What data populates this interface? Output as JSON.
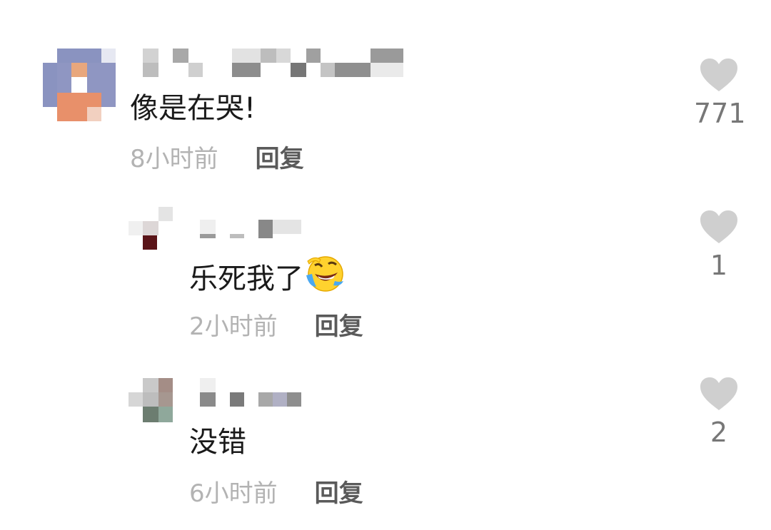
{
  "comments": [
    {
      "text": "像是在哭!",
      "time": "8小时前",
      "reply": "回复",
      "likes": "771",
      "level": "top"
    },
    {
      "text": "乐死我了",
      "emoji": "crying-laughing-emoji",
      "time": "2小时前",
      "reply": "回复",
      "likes": "1",
      "level": "reply"
    },
    {
      "text": "没错",
      "time": "6小时前",
      "reply": "回复",
      "likes": "2",
      "level": "reply"
    }
  ],
  "colors": {
    "heart": "#cfcfcf",
    "time": "#b3b3b3",
    "reply": "#5a5a5a",
    "text": "#1a1a1a"
  }
}
